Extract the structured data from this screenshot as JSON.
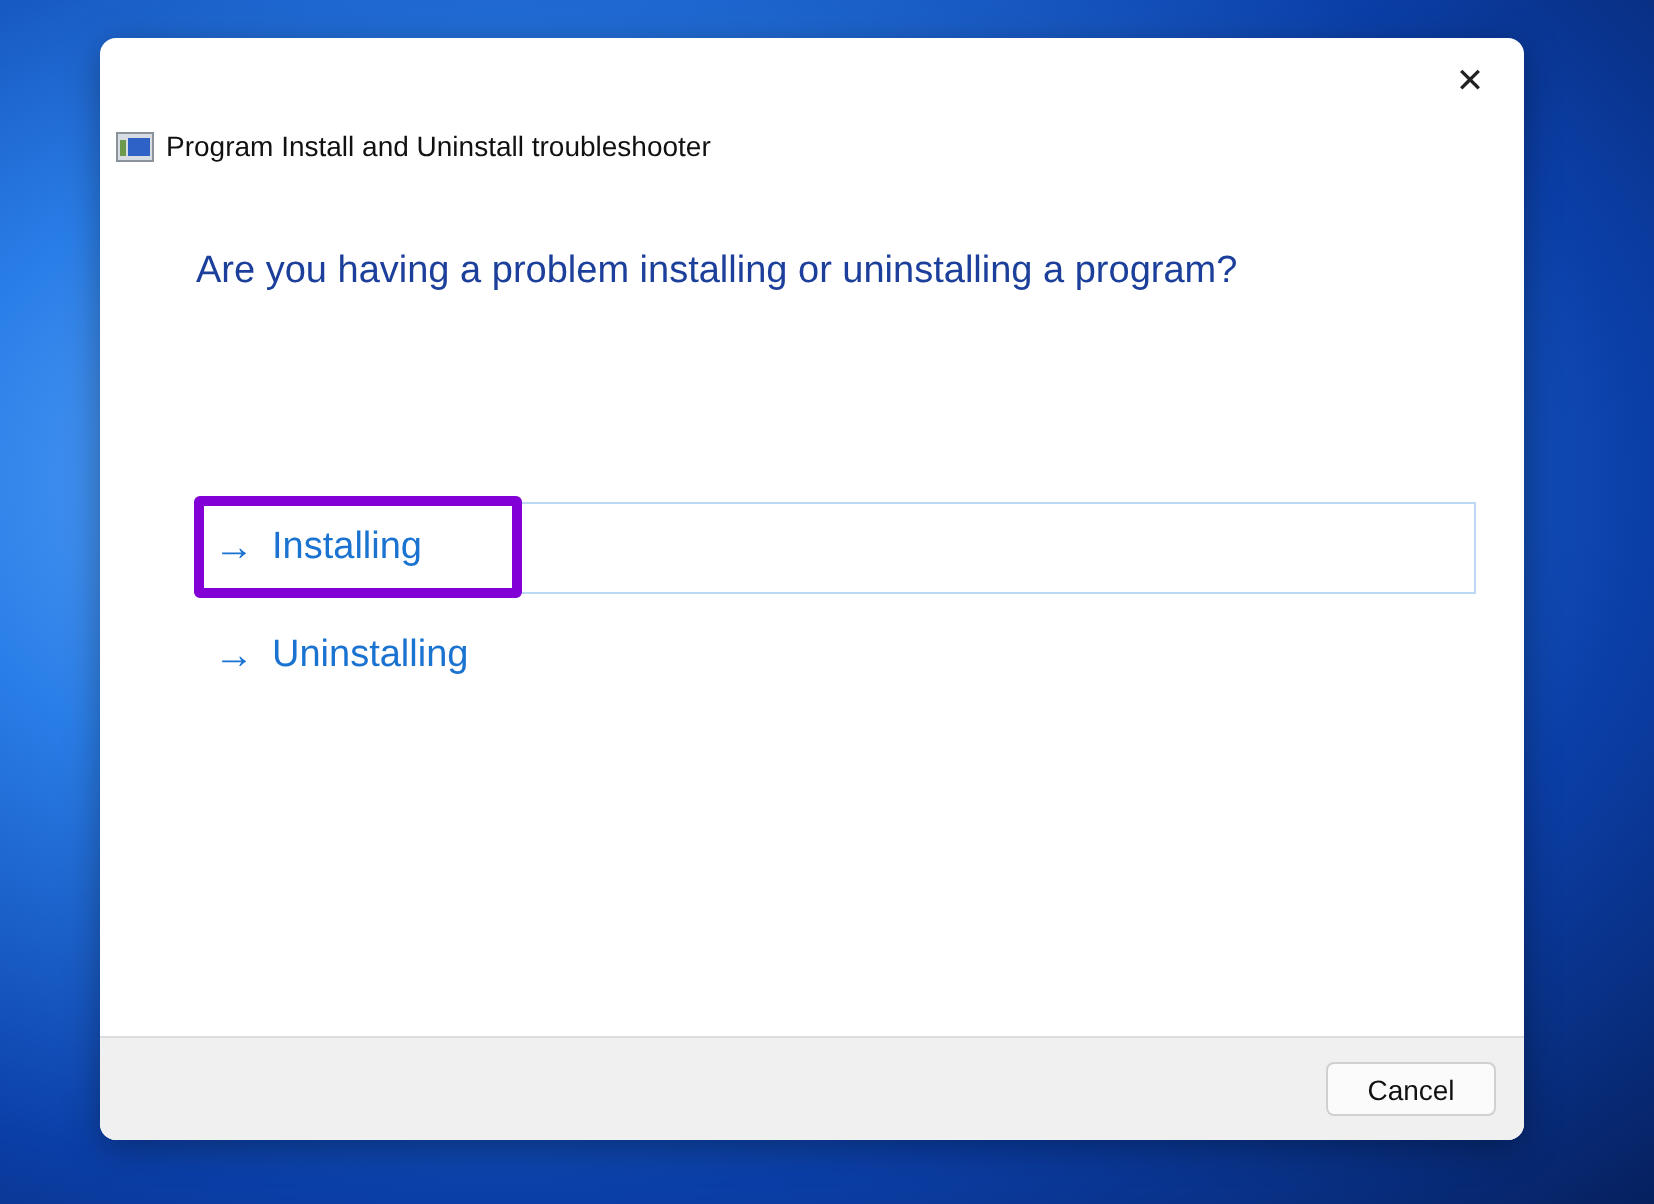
{
  "window": {
    "title": "Program Install and Uninstall troubleshooter",
    "close": "✕"
  },
  "question": "Are you having a problem installing or uninstalling a program?",
  "options": [
    {
      "arrow": "→",
      "label": "Installing",
      "selected": true,
      "highlighted": true
    },
    {
      "arrow": "→",
      "label": "Uninstalling",
      "selected": false,
      "highlighted": false
    }
  ],
  "buttons": [
    "Cancel"
  ]
}
